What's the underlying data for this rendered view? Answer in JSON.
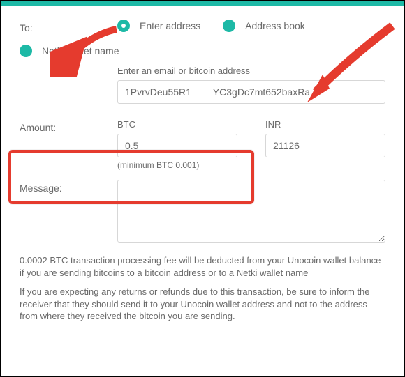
{
  "to": {
    "label": "To:",
    "options": {
      "enter_address": "Enter address",
      "address_book": "Address book",
      "netki": "Netki wallet name"
    }
  },
  "address": {
    "label": "Enter an email or bitcoin address",
    "value": "1PvrvDeu55R1        YC3gDc7mt652baxRa"
  },
  "amount": {
    "label": "Amount:",
    "btc_label": "BTC",
    "btc_value": "0.5",
    "inr_label": "INR",
    "inr_value": "21126",
    "min_text": "(minimum BTC 0.001)"
  },
  "message": {
    "label": "Message:"
  },
  "notes": {
    "fee": "0.0002 BTC transaction processing fee will be deducted from your Unocoin wallet balance if you are sending bitcoins to a bitcoin address or to a Netki wallet name",
    "refund": "If you are expecting any returns or refunds due to this transaction, be sure to inform the receiver that they should send it to your Unocoin wallet address and not to the address from where they received the bitcoin you are sending."
  }
}
